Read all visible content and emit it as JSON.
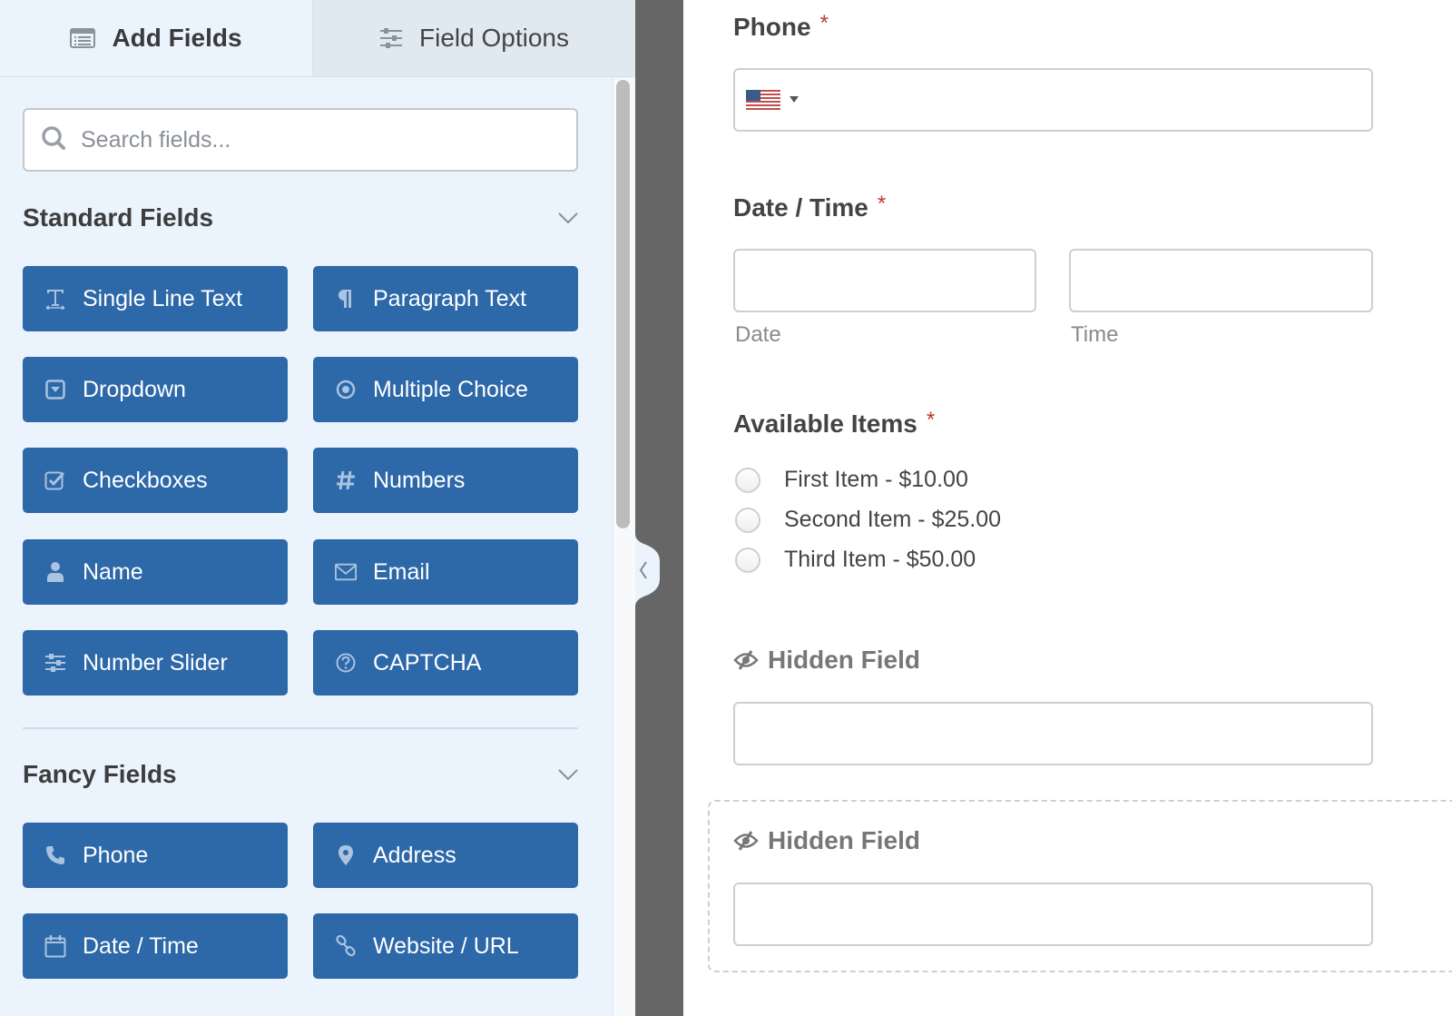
{
  "tabs": {
    "add_fields": {
      "label": "Add Fields",
      "icon": "list-icon"
    },
    "field_options": {
      "label": "Field Options",
      "icon": "sliders-icon"
    }
  },
  "search": {
    "placeholder": "Search fields...",
    "value": "",
    "icon": "search-icon"
  },
  "sections": {
    "standard": {
      "title": "Standard Fields",
      "fields": [
        {
          "label": "Single Line Text",
          "icon": "text-icon"
        },
        {
          "label": "Paragraph Text",
          "icon": "paragraph-icon"
        },
        {
          "label": "Dropdown",
          "icon": "dropdown-icon"
        },
        {
          "label": "Multiple Choice",
          "icon": "radio-icon"
        },
        {
          "label": "Checkboxes",
          "icon": "checkbox-icon"
        },
        {
          "label": "Numbers",
          "icon": "hash-icon"
        },
        {
          "label": "Name",
          "icon": "user-icon"
        },
        {
          "label": "Email",
          "icon": "envelope-icon"
        },
        {
          "label": "Number Slider",
          "icon": "sliders-icon"
        },
        {
          "label": "CAPTCHA",
          "icon": "question-circle-icon"
        }
      ]
    },
    "fancy": {
      "title": "Fancy Fields",
      "fields": [
        {
          "label": "Phone",
          "icon": "phone-icon"
        },
        {
          "label": "Address",
          "icon": "map-pin-icon"
        },
        {
          "label": "Date / Time",
          "icon": "calendar-icon"
        },
        {
          "label": "Website / URL",
          "icon": "link-icon"
        }
      ]
    }
  },
  "colors": {
    "button_bg": "#2d68a8",
    "panel_bg": "#ebf3fc",
    "required": "#c0392b",
    "gutter": "#666666"
  },
  "form": {
    "phone": {
      "label": "Phone",
      "required_mark": "*",
      "country": "US",
      "value": ""
    },
    "datetime": {
      "label": "Date / Time",
      "required_mark": "*",
      "date_sublabel": "Date",
      "time_sublabel": "Time",
      "date_value": "",
      "time_value": ""
    },
    "items": {
      "label": "Available Items",
      "required_mark": "*",
      "options": [
        {
          "label": "First Item - $10.00",
          "checked": false
        },
        {
          "label": "Second Item - $25.00",
          "checked": false
        },
        {
          "label": "Third Item - $50.00",
          "checked": false
        }
      ]
    },
    "hidden1": {
      "label": "Hidden Field",
      "icon": "eye-slash-icon",
      "value": ""
    },
    "hidden2": {
      "label": "Hidden Field",
      "icon": "eye-slash-icon",
      "value": ""
    }
  }
}
